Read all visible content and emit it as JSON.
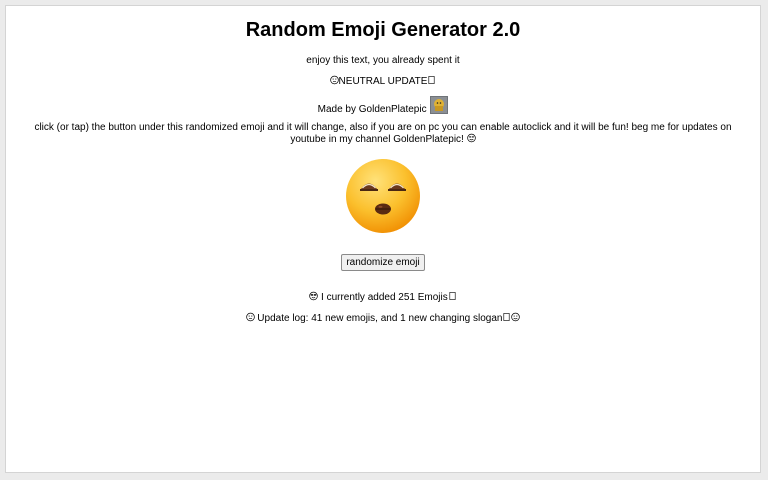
{
  "page": {
    "title": "Random Emoji Generator 2.0",
    "subtitle": "enjoy this text, you already spent it",
    "slogan_text": "NEUTRAL UPDATE",
    "credit": "Made by GoldenPlatepic",
    "instructions": "click (or tap) the button under this randomized emoji and it will change, also if you are on pc you can enable autoclick and it will be fun! beg me for updates on youtube in my channel GoldenPlatepic!",
    "button_label": "randomize emoji",
    "emoji_count_text": "I currently added 251 Emojis",
    "update_log_text": "Update log: 41 new emojis, and 1 new changing slogan"
  },
  "icons": {
    "slogan_prefix": "neutral-face-icon",
    "avatar": "golden-platepic-avatar-icon",
    "current_emoji": "kissing-face-icon",
    "instructions_suffix": "smiling-face-icon",
    "count_prefix": "sunglasses-face-icon",
    "log_prefix": "neutral-face-icon",
    "log_suffix": "smiling-face-icon"
  },
  "colors": {
    "background": "#ebebeb",
    "card": "#ffffff",
    "emoji_yellow": "#f7b21c"
  }
}
